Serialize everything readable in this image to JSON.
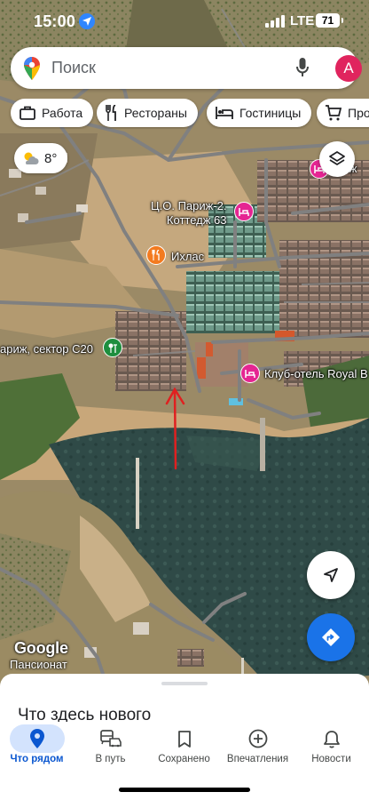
{
  "status_bar": {
    "time": "15:00",
    "network": "LTE",
    "battery": "71"
  },
  "search": {
    "placeholder": "Поиск",
    "avatar_letter": "A"
  },
  "chips": [
    {
      "label": "Работа",
      "icon": "briefcase-icon"
    },
    {
      "label": "Рестораны",
      "icon": "restaurant-icon"
    },
    {
      "label": "Гостиницы",
      "icon": "hotel-icon"
    },
    {
      "label": "Продукты",
      "icon": "cart-icon"
    }
  ],
  "weather": {
    "temperature": "8°",
    "icon": "partly-cloudy-icon"
  },
  "map": {
    "labels": {
      "paris_cottage_line1": "Ц.О. Париж-2.",
      "paris_cottage_line2": "Коттедж 63",
      "ikhlas": "Ихлас",
      "paris_sector": "ариж, сектор С20",
      "club_hotel": "Клуб-отель Royal B",
      "pariz_top": "ариж"
    },
    "attribution": "Google",
    "pansionat": "Пансионат"
  },
  "bottom_sheet": {
    "title": "Что здесь нового"
  },
  "nav": [
    {
      "label": "Что рядом",
      "icon": "location-pin-icon",
      "active": true
    },
    {
      "label": "В путь",
      "icon": "commute-icon",
      "active": false
    },
    {
      "label": "Сохранено",
      "icon": "bookmark-icon",
      "active": false
    },
    {
      "label": "Впечатления",
      "icon": "add-circle-icon",
      "active": false
    },
    {
      "label": "Новости",
      "icon": "bell-icon",
      "active": false
    }
  ],
  "colors": {
    "accent": "#1a73e8",
    "hotel_pin": "#e52592",
    "food_pin": "#f37b20",
    "park_pin": "#1e8e3e",
    "avatar": "#e0245e",
    "annotation_arrow": "#e02020"
  }
}
